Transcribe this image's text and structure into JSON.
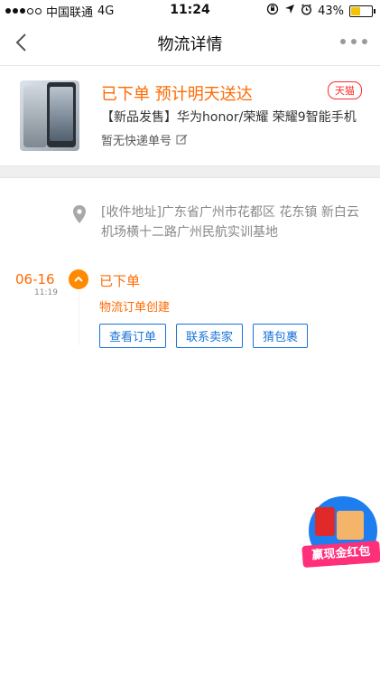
{
  "status_bar": {
    "carrier": "中国联通",
    "network": "4G",
    "time": "11:24",
    "battery": "43%",
    "battery_level": 0.43
  },
  "nav": {
    "title": "物流详情"
  },
  "product": {
    "status_title": "已下单 预计明天送达",
    "badge": "天猫",
    "name": "【新品发售】华为honor/荣耀 荣耀9智能手机",
    "tracking_text": "暂无快递单号"
  },
  "address": {
    "text": "[收件地址]广东省广州市花都区 花东镇 新白云机场横十二路广州民航实训基地"
  },
  "timeline": [
    {
      "date": "06-16",
      "time": "11:19",
      "status": "已下单",
      "desc": "物流订单创建"
    }
  ],
  "actions": {
    "view_order": "查看订单",
    "contact_seller": "联系卖家",
    "guess_package": "猜包裹"
  },
  "promo": {
    "label": "赢现金红包"
  },
  "colors": {
    "accent": "#ff6a00",
    "link": "#1a73d9",
    "tmall": "#ff2a2a"
  }
}
